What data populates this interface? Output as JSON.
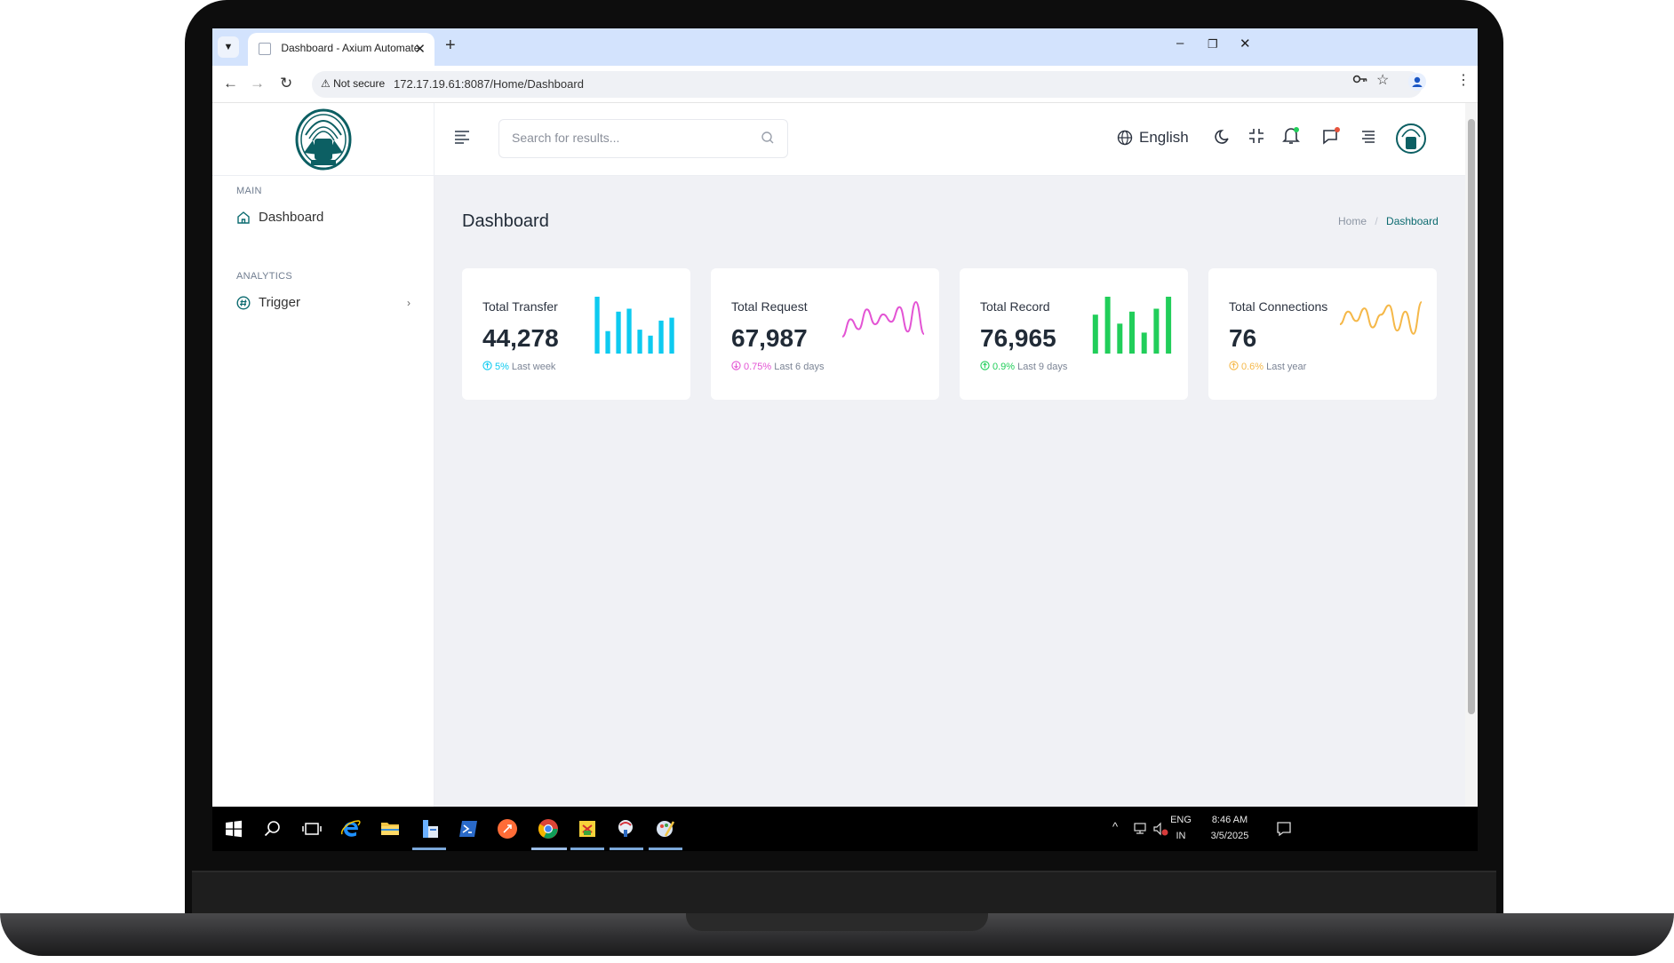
{
  "browser": {
    "tab_title": "Dashboard - Axium Automate",
    "new_tab": "+",
    "not_secure": "Not secure",
    "url": "172.17.19.61:8087/Home/Dashboard",
    "minimize": "–",
    "restore": "❐",
    "close": "✕"
  },
  "sidebar": {
    "section_main": "MAIN",
    "item_dashboard": "Dashboard",
    "section_analytics": "ANALYTICS",
    "item_trigger": "Trigger"
  },
  "topbar": {
    "search_placeholder": "Search for results...",
    "language": "English"
  },
  "page": {
    "title": "Dashboard",
    "breadcrumb_home": "Home",
    "breadcrumb_sep": "/",
    "breadcrumb_current": "Dashboard"
  },
  "cards": [
    {
      "title": "Total Transfer",
      "value": "44,278",
      "change": "5%",
      "period": "Last week",
      "color": "#0dcaf0",
      "chart_type": "bar",
      "chart_values": [
        38,
        15,
        28,
        30,
        16,
        12,
        22,
        24
      ]
    },
    {
      "title": "Total Request",
      "value": "67,987",
      "change": "0.75%",
      "period": "Last 6 days",
      "color": "#e354d4",
      "chart_type": "line",
      "chart_values": [
        8,
        22,
        14,
        30,
        18,
        26,
        20,
        32,
        12,
        36,
        10
      ]
    },
    {
      "title": "Total Record",
      "value": "76,965",
      "change": "0.9%",
      "period": "Last 9 days",
      "color": "#21ce5a",
      "chart_type": "bar",
      "chart_values": [
        26,
        38,
        20,
        28,
        14,
        30,
        38
      ]
    },
    {
      "title": "Total Connections",
      "value": "76",
      "change": "0.6%",
      "period": "Last year",
      "color": "#f5b849",
      "chart_type": "line",
      "chart_values": [
        14,
        22,
        16,
        24,
        12,
        20,
        26,
        10,
        22,
        8,
        28
      ]
    }
  ],
  "taskbar": {
    "lang_line1": "ENG",
    "lang_line2": "IN",
    "time": "8:46 AM",
    "date": "3/5/2025"
  },
  "colors": {
    "brand": "#0c6b70",
    "notification_dot": "#21ce5a",
    "message_dot": "#e6533c"
  }
}
